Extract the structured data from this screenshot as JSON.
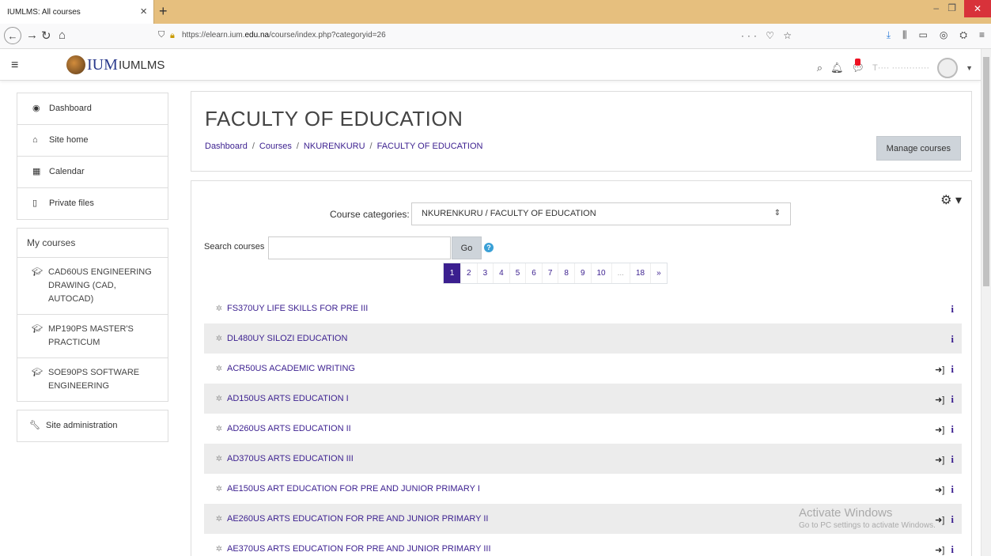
{
  "browser": {
    "tab_title": "IUMLMS: All courses",
    "tab_close": "×",
    "new_tab": "+",
    "url_prefix": "https://elearn.ium.",
    "url_domain": "edu.na",
    "url_path": "/course/index.php?categoryid=26",
    "url_actions": "··· ♡ ☆"
  },
  "header": {
    "logo_text": "IUM",
    "site_name": "IUMLMS",
    "user_name": "T···· ·············"
  },
  "sidebar": {
    "nav": [
      {
        "label": "Dashboard",
        "icon": "dashboard-icon",
        "glyph": "◉"
      },
      {
        "label": "Site home",
        "icon": "home-icon",
        "glyph": "⌂"
      },
      {
        "label": "Calendar",
        "icon": "calendar-icon",
        "glyph": "▦"
      },
      {
        "label": "Private files",
        "icon": "file-icon",
        "glyph": "▯"
      }
    ],
    "my_courses_heading": "My courses",
    "courses": [
      {
        "label": "CAD60US ENGINEERING DRAWING (CAD, AUTOCAD)"
      },
      {
        "label": "MP190PS MASTER'S PRACTICUM"
      },
      {
        "label": "SOE90PS SOFTWARE ENGINEERING"
      }
    ],
    "site_admin": "Site administration"
  },
  "page": {
    "title": "FACULTY OF EDUCATION",
    "breadcrumb": [
      "Dashboard",
      "Courses",
      "NKURENKURU",
      "FACULTY OF EDUCATION"
    ],
    "manage_button": "Manage courses"
  },
  "filters": {
    "category_label": "Course categories:",
    "category_value": "NKURENKURU / FACULTY OF EDUCATION",
    "search_label": "Search courses",
    "search_value": "",
    "go_label": "Go"
  },
  "pagination": {
    "pages": [
      "1",
      "2",
      "3",
      "4",
      "5",
      "6",
      "7",
      "8",
      "9",
      "10",
      "...",
      "18",
      "»"
    ],
    "active": "1"
  },
  "courses": [
    {
      "name": "FS370UY LIFE SKILLS FOR PRE III",
      "enrol": false
    },
    {
      "name": "DL480UY SILOZI EDUCATION",
      "enrol": false
    },
    {
      "name": "ACR50US ACADEMIC WRITING",
      "enrol": true
    },
    {
      "name": "AD150US ARTS EDUCATION I",
      "enrol": true
    },
    {
      "name": "AD260US ARTS EDUCATION II",
      "enrol": true
    },
    {
      "name": "AD370US ARTS EDUCATION III",
      "enrol": true
    },
    {
      "name": "AE150US ART EDUCATION FOR PRE AND JUNIOR PRIMARY I",
      "enrol": true
    },
    {
      "name": "AE260US ARTS EDUCATION FOR PRE AND JUNIOR PRIMARY II",
      "enrol": true
    },
    {
      "name": "AE370US ARTS EDUCATION FOR PRE AND JUNIOR PRIMARY III",
      "enrol": true
    }
  ],
  "watermark": {
    "title": "Activate Windows",
    "subtitle": "Go to PC settings to activate Windows."
  },
  "colors": {
    "primary": "#3b1f8f",
    "tabbar": "#e6bf7e",
    "row_alt": "#ececec"
  }
}
